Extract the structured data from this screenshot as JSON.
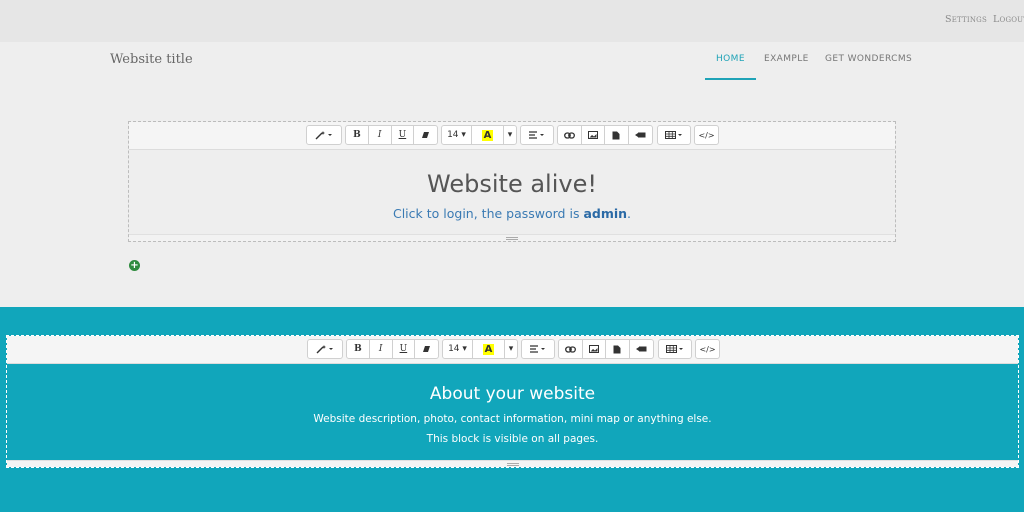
{
  "admin": {
    "settings": "Settings",
    "logout": "Logout"
  },
  "header": {
    "site_title": "Website title",
    "nav": [
      {
        "label": "HOME",
        "active": true
      },
      {
        "label": "EXAMPLE",
        "active": false
      },
      {
        "label": "GET WONDERCMS",
        "active": false
      }
    ]
  },
  "toolbar": {
    "font_size": "14",
    "highlight_letter": "A",
    "highlight_color": "#ffff00",
    "tools": [
      "magic-wand",
      "bold",
      "italic",
      "underline",
      "eraser",
      "font-size",
      "text-color",
      "align",
      "link",
      "image",
      "file",
      "video",
      "table",
      "code-view"
    ],
    "bold": "B",
    "italic": "I",
    "underline": "U",
    "code": "</>"
  },
  "main": {
    "title": "Website alive!",
    "subtitle_prefix": "Click to login, the password is",
    "password": "admin",
    "subtitle_suffix": "."
  },
  "footer": {
    "title": "About your website",
    "line1": "Website description, photo, contact information, mini map or anything else.",
    "line2": "This block is visible on all pages.",
    "background": "#11a6bb"
  },
  "colors": {
    "accent": "#1fa3b7",
    "add_button": "#2e8b3e",
    "link": "#3a7ab3"
  }
}
